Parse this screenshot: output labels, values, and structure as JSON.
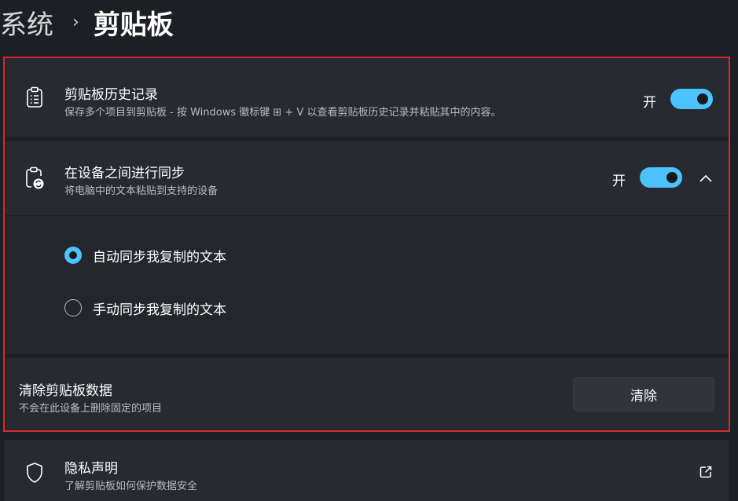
{
  "breadcrumb": {
    "parent": "系统",
    "separator": "›",
    "current": "剪贴板"
  },
  "clipboard_history": {
    "title": "剪贴板历史记录",
    "subtitle": "保存多个项目到剪贴板 - 按 Windows 徽标键 ⊞ + V 以查看剪贴板历史记录并粘贴其中的内容。",
    "toggle_label": "开",
    "toggle_on": true,
    "icon": "clipboard-list-icon"
  },
  "sync_across_devices": {
    "title": "在设备之间进行同步",
    "subtitle": "将电脑中的文本粘贴到支持的设备",
    "toggle_label": "开",
    "toggle_on": true,
    "expanded": true,
    "icon": "clipboard-sync-icon",
    "options": [
      {
        "label": "自动同步我复制的文本",
        "selected": true
      },
      {
        "label": "手动同步我复制的文本",
        "selected": false
      }
    ]
  },
  "clear_data": {
    "title": "清除剪贴板数据",
    "subtitle": "不会在此设备上删除固定的项目",
    "button_label": "清除"
  },
  "privacy": {
    "title": "隐私声明",
    "subtitle": "了解剪贴板如何保护数据安全",
    "icon": "shield-icon",
    "link_icon": "external-link-icon"
  },
  "colors": {
    "accent": "#4cc2ff",
    "background": "#1c1f24",
    "card": "#272b31",
    "highlight_border": "#d8282c"
  }
}
